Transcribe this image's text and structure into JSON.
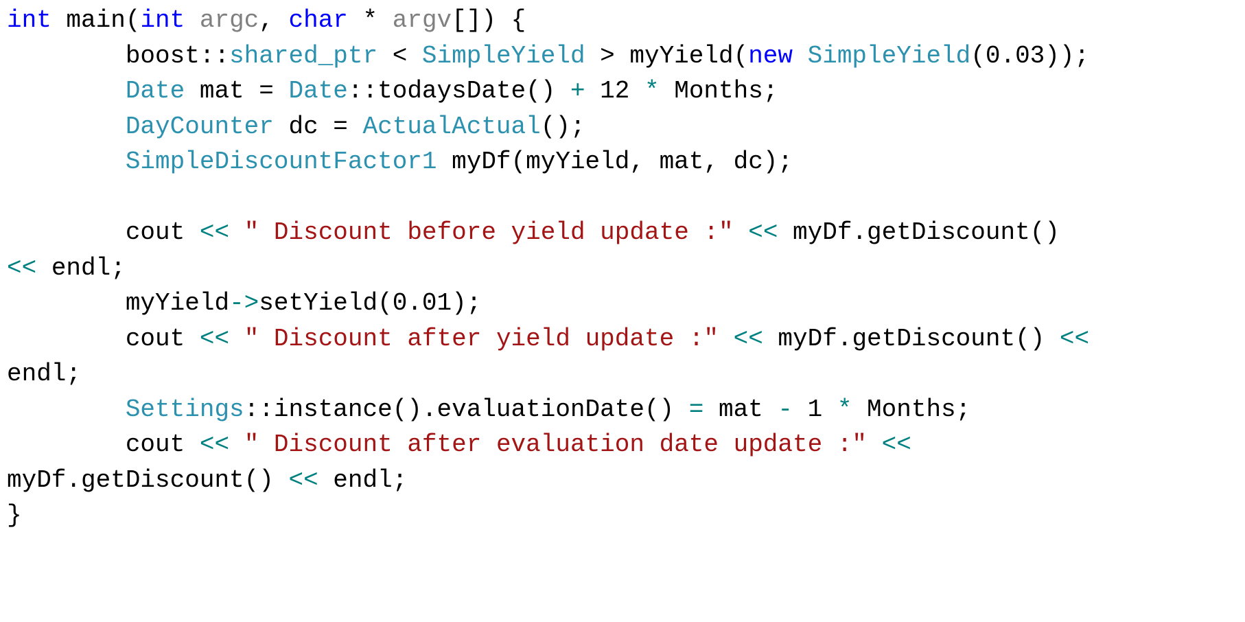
{
  "code": {
    "colors": {
      "plain": "#000000",
      "keyword": "#0000FF",
      "type": "#2B91AF",
      "param": "#808080",
      "string": "#A31515",
      "operator": "#008080"
    },
    "lines": [
      [
        {
          "t": "int",
          "k": "keyword"
        },
        {
          "t": " main(",
          "k": "plain"
        },
        {
          "t": "int",
          "k": "keyword"
        },
        {
          "t": " ",
          "k": "plain"
        },
        {
          "t": "argc",
          "k": "param"
        },
        {
          "t": ", ",
          "k": "plain"
        },
        {
          "t": "char",
          "k": "keyword"
        },
        {
          "t": " * ",
          "k": "plain"
        },
        {
          "t": "argv",
          "k": "param"
        },
        {
          "t": "[]) {",
          "k": "plain"
        }
      ],
      [
        {
          "t": "        boost::",
          "k": "plain"
        },
        {
          "t": "shared_ptr",
          "k": "type"
        },
        {
          "t": " < ",
          "k": "plain"
        },
        {
          "t": "SimpleYield",
          "k": "type"
        },
        {
          "t": " > myYield(",
          "k": "plain"
        },
        {
          "t": "new",
          "k": "keyword"
        },
        {
          "t": " ",
          "k": "plain"
        },
        {
          "t": "SimpleYield",
          "k": "type"
        },
        {
          "t": "(0.03));",
          "k": "plain"
        }
      ],
      [
        {
          "t": "        ",
          "k": "plain"
        },
        {
          "t": "Date",
          "k": "type"
        },
        {
          "t": " mat = ",
          "k": "plain"
        },
        {
          "t": "Date",
          "k": "type"
        },
        {
          "t": "::todaysDate() ",
          "k": "plain"
        },
        {
          "t": "+",
          "k": "operator"
        },
        {
          "t": " 12 ",
          "k": "plain"
        },
        {
          "t": "*",
          "k": "operator"
        },
        {
          "t": " Months;",
          "k": "plain"
        }
      ],
      [
        {
          "t": "        ",
          "k": "plain"
        },
        {
          "t": "DayCounter",
          "k": "type"
        },
        {
          "t": " dc = ",
          "k": "plain"
        },
        {
          "t": "ActualActual",
          "k": "type"
        },
        {
          "t": "();",
          "k": "plain"
        }
      ],
      [
        {
          "t": "        ",
          "k": "plain"
        },
        {
          "t": "SimpleDiscountFactor1",
          "k": "type"
        },
        {
          "t": " myDf(myYield, mat, dc);",
          "k": "plain"
        }
      ],
      [
        {
          "t": "",
          "k": "plain"
        }
      ],
      [
        {
          "t": "        cout ",
          "k": "plain"
        },
        {
          "t": "<<",
          "k": "operator"
        },
        {
          "t": " ",
          "k": "plain"
        },
        {
          "t": "\" Discount before yield update :\"",
          "k": "string"
        },
        {
          "t": " ",
          "k": "plain"
        },
        {
          "t": "<<",
          "k": "operator"
        },
        {
          "t": " myDf.getDiscount()",
          "k": "plain"
        }
      ],
      [
        {
          "t": "<<",
          "k": "operator"
        },
        {
          "t": " endl;",
          "k": "plain"
        }
      ],
      [
        {
          "t": "        myYield",
          "k": "plain"
        },
        {
          "t": "->",
          "k": "operator"
        },
        {
          "t": "setYield(0.01);",
          "k": "plain"
        }
      ],
      [
        {
          "t": "        cout ",
          "k": "plain"
        },
        {
          "t": "<<",
          "k": "operator"
        },
        {
          "t": " ",
          "k": "plain"
        },
        {
          "t": "\" Discount after yield update :\"",
          "k": "string"
        },
        {
          "t": " ",
          "k": "plain"
        },
        {
          "t": "<<",
          "k": "operator"
        },
        {
          "t": " myDf.getDiscount() ",
          "k": "plain"
        },
        {
          "t": "<<",
          "k": "operator"
        }
      ],
      [
        {
          "t": "endl;",
          "k": "plain"
        }
      ],
      [
        {
          "t": "        ",
          "k": "plain"
        },
        {
          "t": "Settings",
          "k": "type"
        },
        {
          "t": "::instance().evaluationDate() ",
          "k": "plain"
        },
        {
          "t": "=",
          "k": "operator"
        },
        {
          "t": " mat ",
          "k": "plain"
        },
        {
          "t": "-",
          "k": "operator"
        },
        {
          "t": " 1 ",
          "k": "plain"
        },
        {
          "t": "*",
          "k": "operator"
        },
        {
          "t": " Months;",
          "k": "plain"
        }
      ],
      [
        {
          "t": "        cout ",
          "k": "plain"
        },
        {
          "t": "<<",
          "k": "operator"
        },
        {
          "t": " ",
          "k": "plain"
        },
        {
          "t": "\" Discount after evaluation date update :\"",
          "k": "string"
        },
        {
          "t": " ",
          "k": "plain"
        },
        {
          "t": "<<",
          "k": "operator"
        }
      ],
      [
        {
          "t": "myDf.getDiscount() ",
          "k": "plain"
        },
        {
          "t": "<<",
          "k": "operator"
        },
        {
          "t": " endl;",
          "k": "plain"
        }
      ],
      [
        {
          "t": "}",
          "k": "plain"
        }
      ]
    ]
  }
}
